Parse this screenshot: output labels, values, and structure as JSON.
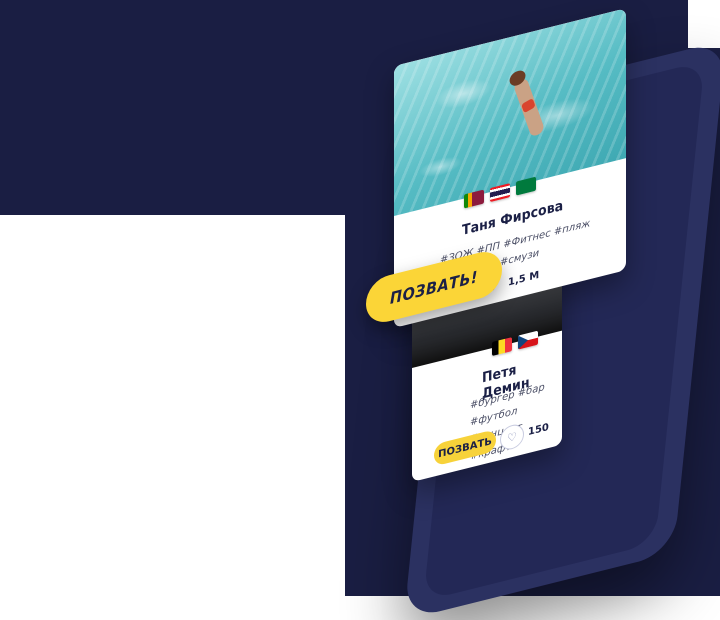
{
  "profiles": [
    {
      "name": "Таня Фирсова",
      "tags_line1": "#ЗОЖ #ПП #Фитнес #пляж",
      "tags_line2": "#смузи",
      "likes": "1,5 М",
      "flags": [
        "sri-lanka",
        "thailand",
        "seychelles"
      ]
    },
    {
      "name": "Петя Демин",
      "tags_line1": "#бургер #бар #футбол",
      "tags_line2": "#концерт #крафт",
      "likes": "150",
      "button_label": "ПОЗВАТЬ",
      "flags": [
        "belgium",
        "czech-republic"
      ]
    }
  ],
  "cta_label": "ПОЗВАТЬ!",
  "colors": {
    "navy": "#1a1e43",
    "accent_yellow": "#fbd537",
    "like_red": "#d1203e"
  }
}
